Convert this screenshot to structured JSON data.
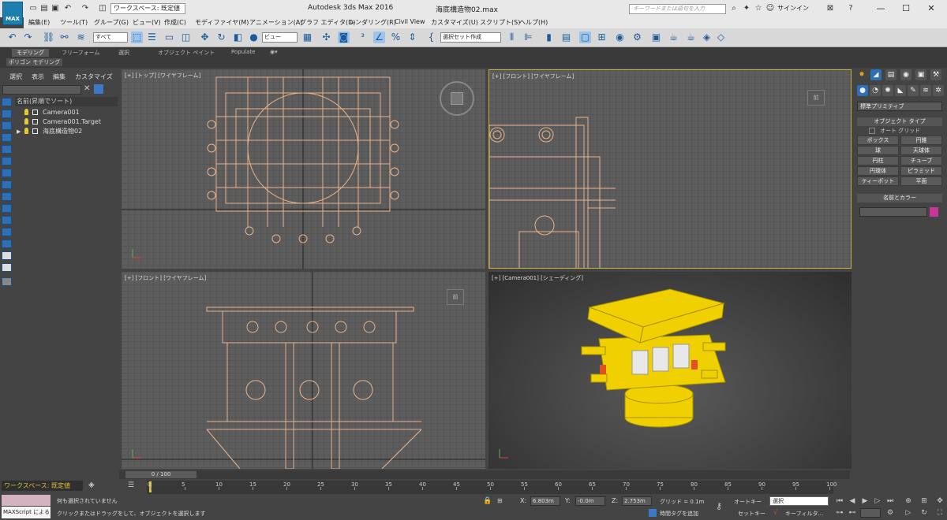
{
  "app": {
    "title": "Autodesk 3ds Max 2016",
    "file": "海底構造物02.max",
    "logo": "MAX",
    "workspace": "ワークスペース: 既定値",
    "search_placeholder": "キーワードまたは語句を入力",
    "signin": "サインイン"
  },
  "menu": [
    "編集(E)",
    "ツール(T)",
    "グループ(G)",
    "ビュー(V)",
    "作成(C)",
    "モディファイヤ(M)",
    "アニメーション(A)",
    "グラフ エディタ(D)",
    "レンダリング(R)",
    "Civil View",
    "カスタマイズ(U)",
    "スクリプト(S)",
    "ヘルプ(H)"
  ],
  "toolbar": {
    "filter": "すべて",
    "refcoord": "ビュー",
    "selset": "選択セット作成"
  },
  "ribbon": {
    "tabs": [
      "モデリング",
      "フリーフォーム",
      "選択",
      "オブジェクト ペイント",
      "Populate"
    ],
    "sub": "ポリゴン モデリング"
  },
  "scene_explorer": {
    "menu": [
      "選択",
      "表示",
      "編集",
      "カスタマイズ"
    ],
    "header": "名前(昇順でソート)",
    "items": [
      "Camera001",
      "Camera001.Target",
      "海底構造物02"
    ]
  },
  "viewports": {
    "top": "[+] [トップ] [ワイヤフレーム]",
    "front_right": "[+] [フロント] [ワイヤフレーム]",
    "front_bottom": "[+] [フロント] [ワイヤフレーム]",
    "camera": "[+] [Camera001] [シェーディング]",
    "cube_front": "前"
  },
  "command_panel": {
    "category": "標準プリミティブ",
    "object_type_title": "オブジェクト タイプ",
    "autogrid": "オート グリッド",
    "buttons": [
      "ボックス",
      "円錐",
      "球",
      "天球体",
      "円柱",
      "チューブ",
      "円環体",
      "ピラミッド",
      "ティーポット",
      "平面"
    ],
    "name_color_title": "名前とカラー",
    "object_color": "#c8369b"
  },
  "timeline": {
    "slider": "0 / 100",
    "ticks": [
      "0",
      "5",
      "10",
      "15",
      "20",
      "25",
      "30",
      "35",
      "40",
      "45",
      "50",
      "55",
      "60",
      "65",
      "70",
      "75",
      "80",
      "85",
      "90",
      "95",
      "100"
    ]
  },
  "status": {
    "maxscript": "MAXScript による",
    "line1": "何も選択されていません",
    "line2": "クリックまたはドラッグをして、オブジェクトを選択します",
    "x": "6.803m",
    "y": "-0.0m",
    "z": "2.753m",
    "grid": "グリッド = 0.1m",
    "timetag": "時間タグを追加",
    "autokey": "オートキー",
    "setkey": "セットキー",
    "select": "選択",
    "keyfilter": "キーフィルタ..."
  }
}
